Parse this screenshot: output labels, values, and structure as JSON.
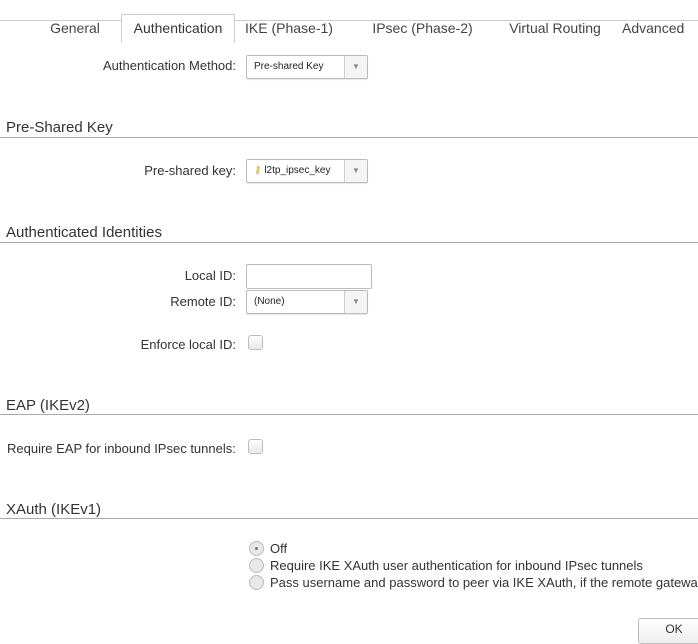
{
  "tabs": [
    "General",
    "Authentication",
    "IKE (Phase-1)",
    "IPsec (Phase-2)",
    "Virtual Routing",
    "Advanced"
  ],
  "active_tab": "Authentication",
  "auth_method": {
    "label": "Authentication Method:",
    "value": "Pre-shared Key"
  },
  "psk_section": {
    "title": "Pre-Shared Key",
    "label": "Pre-shared key:",
    "value": "l2tp_ipsec_key"
  },
  "identities": {
    "title": "Authenticated Identities",
    "local_id_label": "Local ID:",
    "local_id_value": "",
    "remote_id_label": "Remote ID:",
    "remote_id_value": "(None)",
    "enforce_label": "Enforce local ID:",
    "enforce_checked": false
  },
  "eap": {
    "title": "EAP (IKEv2)",
    "label": "Require EAP for inbound IPsec tunnels:",
    "checked": false
  },
  "xauth": {
    "title": "XAuth (IKEv1)",
    "options": [
      "Off",
      "Require IKE XAuth user authentication for inbound IPsec tunnels",
      "Pass username and password to peer via IKE XAuth, if the remote gateway"
    ],
    "selected": 0
  },
  "ok_label": "OK"
}
